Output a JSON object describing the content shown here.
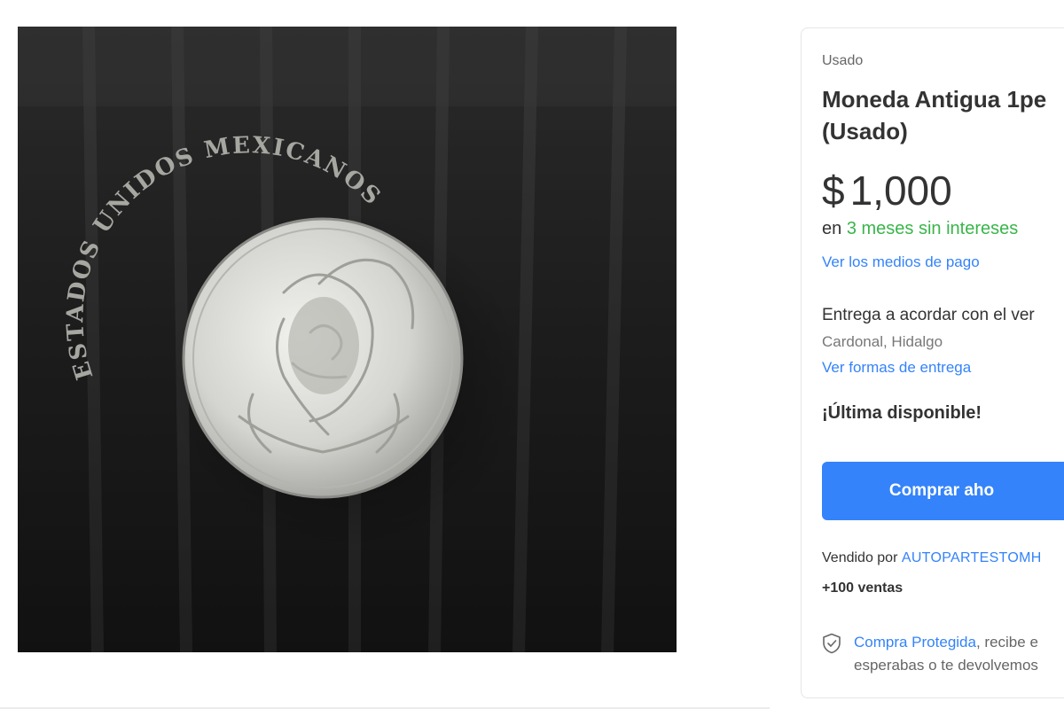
{
  "product": {
    "condition": "Usado",
    "title_line1": "Moneda Antigua 1pe",
    "title_line2": "(Usado)",
    "currency": "$",
    "price": "1,000",
    "installments_prefix": "en",
    "installments_highlight": "3 meses sin intereses",
    "payment_link": "Ver los medios de pago",
    "delivery_text": "Entrega a acordar con el ver",
    "location": "Cardonal, Hidalgo",
    "shipping_link": "Ver formas de entrega",
    "stock_message": "¡Última disponible!",
    "buy_button": "Comprar aho"
  },
  "seller": {
    "prefix": "Vendido por",
    "name": "AUTOPARTESTOMH",
    "sales": "+100 ventas"
  },
  "protection": {
    "link": "Compra Protegida",
    "text_line1_rest": ", recibe e",
    "text_line2": "esperabas o te devolvemos"
  },
  "coin": {
    "inscription_upper": "ESTADOS UNIDOS MEXICANOS"
  },
  "icons": {
    "shield": "shield-check-icon"
  },
  "colors": {
    "accent": "#3483fa",
    "installment_green": "#39b54a",
    "text": "#333333",
    "muted": "#666666"
  }
}
